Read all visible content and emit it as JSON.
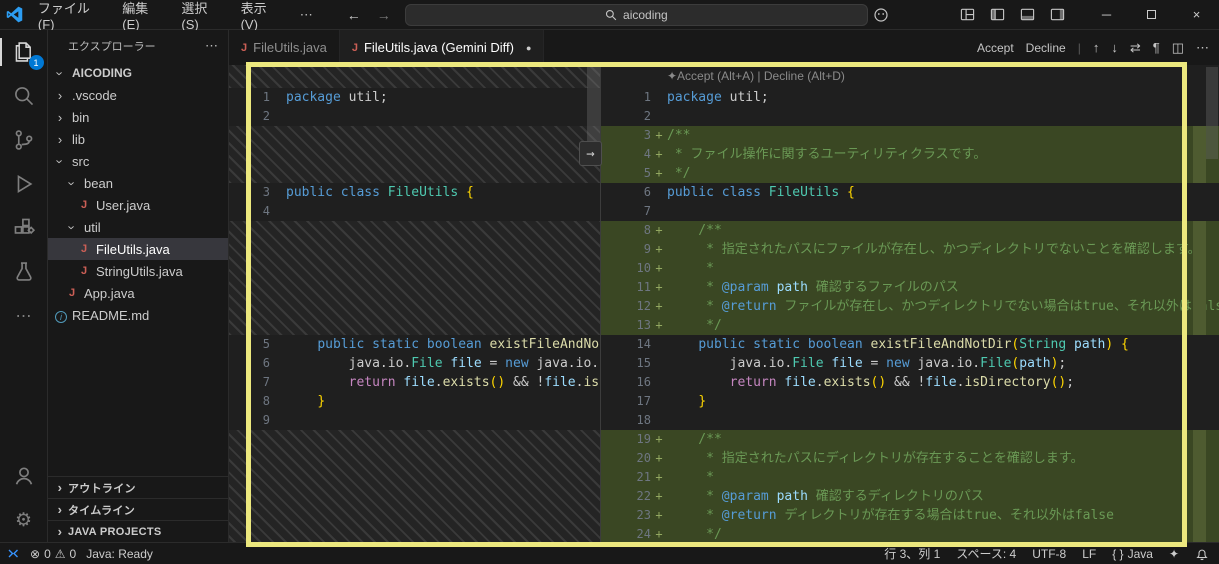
{
  "colors": {
    "accent": "#0078d4",
    "added-bg": "#3a4723",
    "annotation": "#ece87e",
    "java": "#cc5f56"
  },
  "icons": {
    "chevron": "›",
    "more": "⋯",
    "back": "←",
    "forward": "→",
    "minimize": "─",
    "close": "×",
    "dot": "●",
    "arrow-up": "↑",
    "arrow-down": "↓",
    "swap": "⇄",
    "pilcrow": "¶",
    "split": "◫",
    "gear": "⚙",
    "error": "⊗",
    "warning": "⚠",
    "sparkle": "✦",
    "arrow-right": "→",
    "braces": "{ }"
  },
  "titlebar": {
    "menus": [
      "ファイル(F)",
      "編集(E)",
      "選択(S)",
      "表示(V)"
    ],
    "search": "aicoding"
  },
  "activity_bar": {
    "explorer_badge": "1"
  },
  "sidebar": {
    "header": "エクスプローラー",
    "tree": [
      {
        "label": "AICODING",
        "depth": 0,
        "kind": "root",
        "state": "expanded"
      },
      {
        "label": ".vscode",
        "depth": 0,
        "kind": "folder",
        "state": "collapsed"
      },
      {
        "label": "bin",
        "depth": 0,
        "kind": "folder",
        "state": "collapsed"
      },
      {
        "label": "lib",
        "depth": 0,
        "kind": "folder",
        "state": "collapsed"
      },
      {
        "label": "src",
        "depth": 0,
        "kind": "folder",
        "state": "expanded"
      },
      {
        "label": "bean",
        "depth": 1,
        "kind": "folder",
        "state": "expanded"
      },
      {
        "label": "User.java",
        "depth": 2,
        "kind": "file",
        "icon": "java"
      },
      {
        "label": "util",
        "depth": 1,
        "kind": "folder",
        "state": "expanded"
      },
      {
        "label": "FileUtils.java",
        "depth": 2,
        "kind": "file",
        "icon": "java",
        "selected": true
      },
      {
        "label": "StringUtils.java",
        "depth": 2,
        "kind": "file",
        "icon": "java"
      },
      {
        "label": "App.java",
        "depth": 1,
        "kind": "file",
        "icon": "java"
      },
      {
        "label": "README.md",
        "depth": 0,
        "kind": "file",
        "icon": "info"
      }
    ],
    "sections": [
      "アウトライン",
      "タイムライン",
      "JAVA PROJECTS"
    ]
  },
  "tabs": [
    {
      "label": "FileUtils.java"
    },
    {
      "label": "FileUtils.java (Gemini Diff)"
    }
  ],
  "editor_actions": {
    "accept": "Accept",
    "decline": "Decline"
  },
  "diff": {
    "hint": "✦Accept (Alt+A) | Decline (Alt+D)",
    "left": [
      {
        "fh": 23
      },
      {
        "n": "1",
        "t": [
          [
            "kw",
            "package"
          ],
          [
            "pl",
            " util;"
          ]
        ]
      },
      {
        "n": "2",
        "t": []
      },
      {
        "f": 3
      },
      {
        "n": "3",
        "t": [
          [
            "kw",
            "public"
          ],
          [
            "pl",
            " "
          ],
          [
            "kw",
            "class"
          ],
          [
            "pl",
            " "
          ],
          [
            "ty",
            "FileUtils"
          ],
          [
            "pl",
            " "
          ],
          [
            "br",
            "{"
          ]
        ]
      },
      {
        "n": "4",
        "t": []
      },
      {
        "f": 6
      },
      {
        "n": "5",
        "t": [
          [
            "pl",
            "    "
          ],
          [
            "kw",
            "public"
          ],
          [
            "pl",
            " "
          ],
          [
            "kw",
            "static"
          ],
          [
            "pl",
            " "
          ],
          [
            "kw",
            "boolean"
          ],
          [
            "pl",
            " "
          ],
          [
            "fn",
            "existFileAndNotDir"
          ],
          [
            "br",
            "("
          ],
          [
            "ty",
            "String"
          ],
          [
            "pl",
            " "
          ],
          [
            "va",
            "path"
          ],
          [
            "br",
            ")"
          ],
          [
            "pl",
            " "
          ],
          [
            "br",
            "{"
          ]
        ]
      },
      {
        "n": "6",
        "t": [
          [
            "pl",
            "        java.io."
          ],
          [
            "ty",
            "File"
          ],
          [
            "pl",
            " "
          ],
          [
            "va",
            "file"
          ],
          [
            "pl",
            " = "
          ],
          [
            "kw",
            "new"
          ],
          [
            "pl",
            " java.io."
          ],
          [
            "ty",
            "File"
          ],
          [
            "br",
            "("
          ],
          [
            "va",
            "path"
          ],
          [
            "br",
            ")"
          ],
          [
            "pl",
            ";"
          ]
        ]
      },
      {
        "n": "7",
        "t": [
          [
            "pl",
            "        "
          ],
          [
            "ct",
            "return"
          ],
          [
            "pl",
            " "
          ],
          [
            "va",
            "file"
          ],
          [
            "pl",
            "."
          ],
          [
            "fn",
            "exists"
          ],
          [
            "br",
            "()"
          ],
          [
            "pl",
            " && !"
          ],
          [
            "va",
            "file"
          ],
          [
            "pl",
            "."
          ],
          [
            "fn",
            "isDirectory"
          ],
          [
            "br",
            "()"
          ],
          [
            "pl",
            ";"
          ]
        ]
      },
      {
        "n": "8",
        "t": [
          [
            "pl",
            "    "
          ],
          [
            "br",
            "}"
          ]
        ]
      },
      {
        "n": "9",
        "t": []
      },
      {
        "f": 7
      }
    ],
    "right": [
      {
        "n": "1",
        "t": [
          [
            "kw",
            "package"
          ],
          [
            "pl",
            " util;"
          ]
        ]
      },
      {
        "n": "2",
        "t": []
      },
      {
        "n": "3",
        "a": true,
        "t": [
          [
            "cm",
            "/**"
          ]
        ]
      },
      {
        "n": "4",
        "a": true,
        "t": [
          [
            "cm",
            " * ファイル操作に関するユーティリティクラスです。"
          ]
        ]
      },
      {
        "n": "5",
        "a": true,
        "t": [
          [
            "cm",
            " */"
          ]
        ]
      },
      {
        "n": "6",
        "t": [
          [
            "kw",
            "public"
          ],
          [
            "pl",
            " "
          ],
          [
            "kw",
            "class"
          ],
          [
            "pl",
            " "
          ],
          [
            "ty",
            "FileUtils"
          ],
          [
            "pl",
            " "
          ],
          [
            "br",
            "{"
          ]
        ]
      },
      {
        "n": "7",
        "t": []
      },
      {
        "n": "8",
        "a": true,
        "t": [
          [
            "cm",
            "    /**"
          ]
        ]
      },
      {
        "n": "9",
        "a": true,
        "t": [
          [
            "cm",
            "     * 指定されたパスにファイルが存在し、かつディレクトリでないことを確認します。"
          ]
        ]
      },
      {
        "n": "10",
        "a": true,
        "t": [
          [
            "cm",
            "     *"
          ]
        ]
      },
      {
        "n": "11",
        "a": true,
        "t": [
          [
            "cm",
            "     * "
          ],
          [
            "tg",
            "@param"
          ],
          [
            "cm",
            " "
          ],
          [
            "va",
            "path"
          ],
          [
            "cm",
            " 確認するファイルのパス"
          ]
        ]
      },
      {
        "n": "12",
        "a": true,
        "t": [
          [
            "cm",
            "     * "
          ],
          [
            "tg",
            "@return"
          ],
          [
            "cm",
            " ファイルが存在し、かつディレクトリでない場合はtrue、それ以外はfalse"
          ]
        ]
      },
      {
        "n": "13",
        "a": true,
        "t": [
          [
            "cm",
            "     */"
          ]
        ]
      },
      {
        "n": "14",
        "t": [
          [
            "pl",
            "    "
          ],
          [
            "kw",
            "public"
          ],
          [
            "pl",
            " "
          ],
          [
            "kw",
            "static"
          ],
          [
            "pl",
            " "
          ],
          [
            "kw",
            "boolean"
          ],
          [
            "pl",
            " "
          ],
          [
            "fn",
            "existFileAndNotDir"
          ],
          [
            "br",
            "("
          ],
          [
            "ty",
            "String"
          ],
          [
            "pl",
            " "
          ],
          [
            "va",
            "path"
          ],
          [
            "br",
            ")"
          ],
          [
            "pl",
            " "
          ],
          [
            "br",
            "{"
          ]
        ]
      },
      {
        "n": "15",
        "t": [
          [
            "pl",
            "        java.io."
          ],
          [
            "ty",
            "File"
          ],
          [
            "pl",
            " "
          ],
          [
            "va",
            "file"
          ],
          [
            "pl",
            " = "
          ],
          [
            "kw",
            "new"
          ],
          [
            "pl",
            " java.io."
          ],
          [
            "ty",
            "File"
          ],
          [
            "br",
            "("
          ],
          [
            "va",
            "path"
          ],
          [
            "br",
            ")"
          ],
          [
            "pl",
            ";"
          ]
        ]
      },
      {
        "n": "16",
        "t": [
          [
            "pl",
            "        "
          ],
          [
            "ct",
            "return"
          ],
          [
            "pl",
            " "
          ],
          [
            "va",
            "file"
          ],
          [
            "pl",
            "."
          ],
          [
            "fn",
            "exists"
          ],
          [
            "br",
            "()"
          ],
          [
            "pl",
            " && !"
          ],
          [
            "va",
            "file"
          ],
          [
            "pl",
            "."
          ],
          [
            "fn",
            "isDirectory"
          ],
          [
            "br",
            "()"
          ],
          [
            "pl",
            ";"
          ]
        ]
      },
      {
        "n": "17",
        "t": [
          [
            "pl",
            "    "
          ],
          [
            "br",
            "}"
          ]
        ]
      },
      {
        "n": "18",
        "t": []
      },
      {
        "n": "19",
        "a": true,
        "t": [
          [
            "cm",
            "    /**"
          ]
        ]
      },
      {
        "n": "20",
        "a": true,
        "t": [
          [
            "cm",
            "     * 指定されたパスにディレクトリが存在することを確認します。"
          ]
        ]
      },
      {
        "n": "21",
        "a": true,
        "t": [
          [
            "cm",
            "     *"
          ]
        ]
      },
      {
        "n": "22",
        "a": true,
        "t": [
          [
            "cm",
            "     * "
          ],
          [
            "tg",
            "@param"
          ],
          [
            "cm",
            " "
          ],
          [
            "va",
            "path"
          ],
          [
            "cm",
            " 確認するディレクトリのパス"
          ]
        ]
      },
      {
        "n": "23",
        "a": true,
        "t": [
          [
            "cm",
            "     * "
          ],
          [
            "tg",
            "@return"
          ],
          [
            "cm",
            " ディレクトリが存在する場合はtrue、それ以外はfalse"
          ]
        ]
      },
      {
        "n": "24",
        "a": true,
        "t": [
          [
            "cm",
            "     */"
          ]
        ]
      }
    ]
  },
  "status_bar": {
    "errors": "0",
    "warnings": "0",
    "java_status": "Java: Ready",
    "line_col": "行 3、列 1",
    "indent": "スペース: 4",
    "encoding": "UTF-8",
    "eol": "LF",
    "language": "Java"
  }
}
